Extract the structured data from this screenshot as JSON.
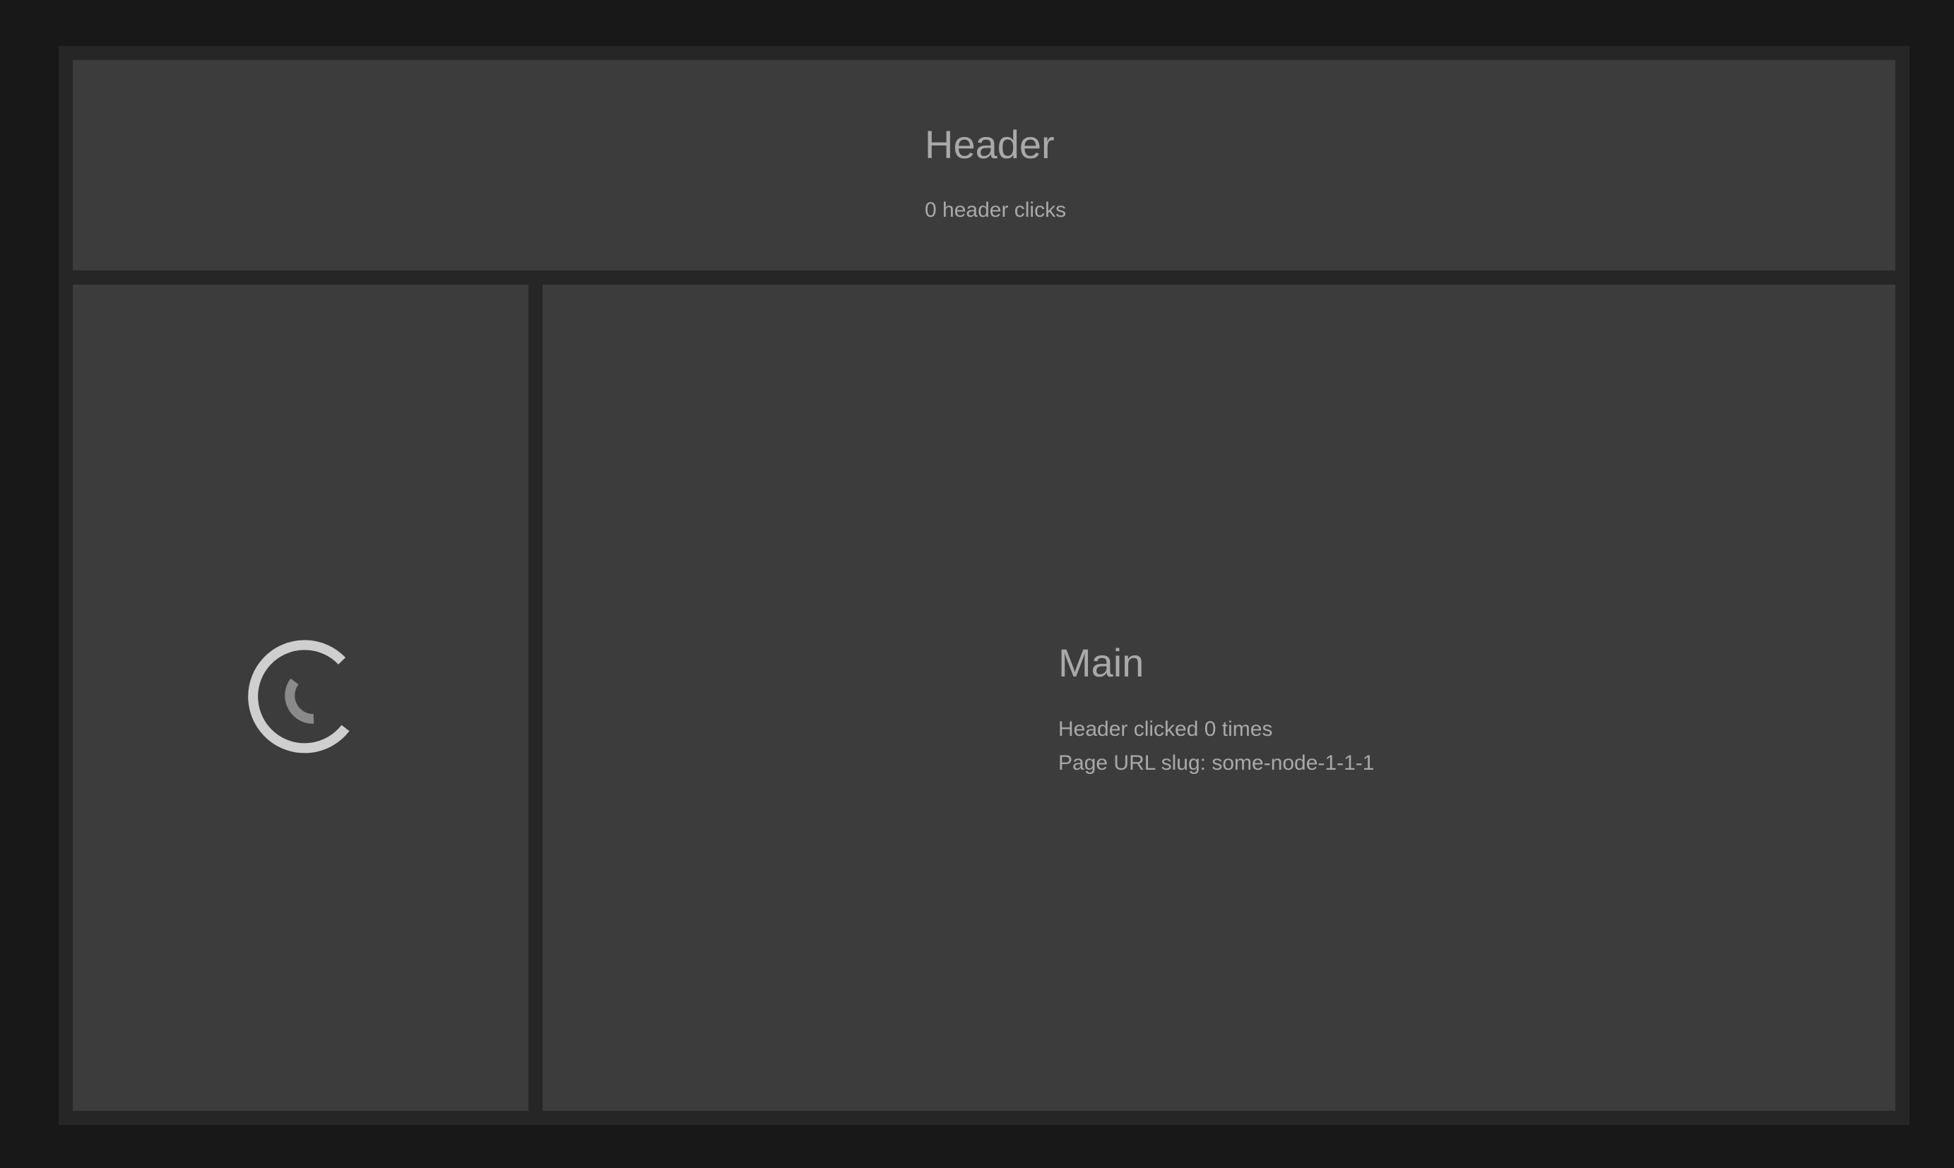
{
  "header": {
    "title": "Header",
    "clicks_text": "0 header clicks"
  },
  "sidebar": {
    "loading_icon": "spinner-icon"
  },
  "main": {
    "title": "Main",
    "clicked_text": "Header clicked 0 times",
    "slug_text": "Page URL slug: some-node-1-1-1"
  },
  "colors": {
    "background": "#181818",
    "frame": "#262626",
    "panel": "#3c3c3c",
    "text": "#a9a9a9",
    "spinner_outer": "#cfcfcf",
    "spinner_inner": "#8a8a8a"
  }
}
